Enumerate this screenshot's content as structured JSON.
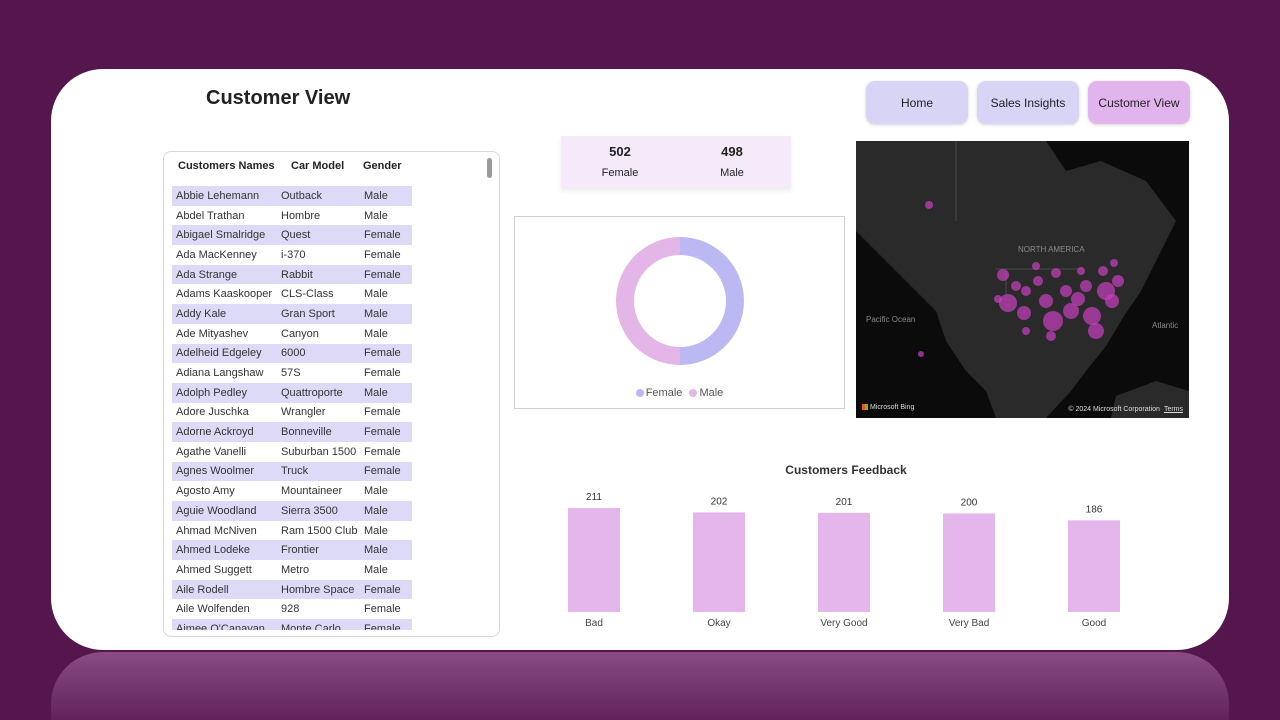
{
  "page": {
    "title": "Customer View"
  },
  "nav": [
    {
      "label": "Home",
      "active": false
    },
    {
      "label": "Sales Insights",
      "active": false
    },
    {
      "label": "Customer View",
      "active": true
    }
  ],
  "table": {
    "headers": [
      "Customers Names",
      "Car Model",
      "Gender"
    ],
    "rows": [
      [
        "Abbie Lehemann",
        "Outback",
        "Male"
      ],
      [
        "Abdel Trathan",
        "Hombre",
        "Male"
      ],
      [
        "Abigael Smalridge",
        "Quest",
        "Female"
      ],
      [
        "Ada MacKenney",
        "i-370",
        "Female"
      ],
      [
        "Ada Strange",
        "Rabbit",
        "Female"
      ],
      [
        "Adams Kaaskooper",
        "CLS-Class",
        "Male"
      ],
      [
        "Addy Kale",
        "Gran Sport",
        "Male"
      ],
      [
        "Ade Mityashev",
        "Canyon",
        "Male"
      ],
      [
        "Adelheid Edgeley",
        "6000",
        "Female"
      ],
      [
        "Adiana Langshaw",
        "57S",
        "Female"
      ],
      [
        "Adolph Pedley",
        "Quattroporte",
        "Male"
      ],
      [
        "Adore Juschka",
        "Wrangler",
        "Female"
      ],
      [
        "Adorne Ackroyd",
        "Bonneville",
        "Female"
      ],
      [
        "Agathe Vanelli",
        "Suburban 1500",
        "Female"
      ],
      [
        "Agnes Woolmer",
        "Truck",
        "Female"
      ],
      [
        "Agosto Amy",
        "Mountaineer",
        "Male"
      ],
      [
        "Aguie Woodland",
        "Sierra 3500",
        "Male"
      ],
      [
        "Ahmad McNiven",
        "Ram 1500 Club",
        "Male"
      ],
      [
        "Ahmed Lodeke",
        "Frontier",
        "Male"
      ],
      [
        "Ahmed Suggett",
        "Metro",
        "Male"
      ],
      [
        "Aile Rodell",
        "Hombre Space",
        "Female"
      ],
      [
        "Aile Wolfenden",
        "928",
        "Female"
      ],
      [
        "Aimee O'Canavan",
        "Monte Carlo",
        "Female"
      ]
    ]
  },
  "kpi": [
    {
      "value": "502",
      "label": "Female"
    },
    {
      "value": "498",
      "label": "Male"
    }
  ],
  "donut": {
    "legend": [
      "Female",
      "Male"
    ],
    "values": [
      502,
      498
    ],
    "colors": [
      "#bcb8f4",
      "#e4b6e8"
    ]
  },
  "map": {
    "labels": {
      "continent": "NORTH AMERICA",
      "pacific": "Pacific Ocean",
      "atlantic": "Atlantic"
    },
    "brand": "Microsoft Bing",
    "copyright": "© 2024 Microsoft Corporation",
    "terms": "Terms",
    "bubble_color": "#c940c0"
  },
  "chart_data": {
    "type": "bar",
    "title": "Customers Feedback",
    "categories": [
      "Bad",
      "Okay",
      "Very Good",
      "Very Bad",
      "Good"
    ],
    "values": [
      211,
      202,
      201,
      200,
      186
    ],
    "ylim": [
      0,
      211
    ],
    "color": "#e4b6ec"
  }
}
